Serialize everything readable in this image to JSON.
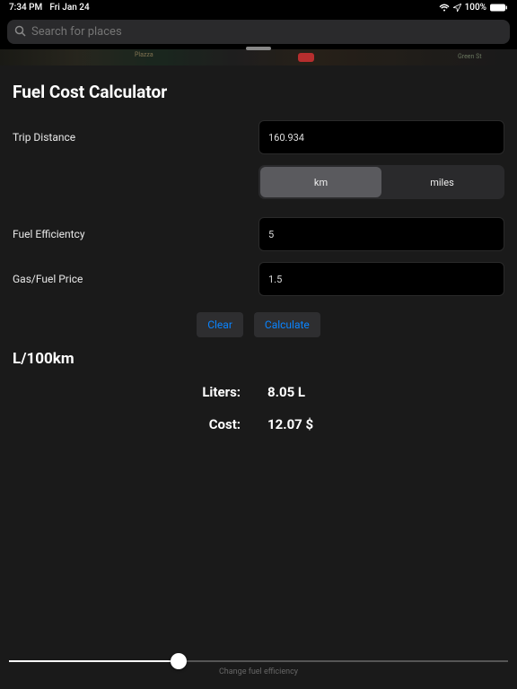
{
  "status": {
    "time": "7:34 PM",
    "date": "Fri Jan 24",
    "battery": "100%"
  },
  "search": {
    "placeholder": "Search for places"
  },
  "map": {
    "label1": "Plazza",
    "label2": "Green St"
  },
  "page": {
    "title": "Fuel Cost Calculator"
  },
  "fields": {
    "trip_distance": {
      "label": "Trip Distance",
      "value": "160.934"
    },
    "fuel_efficiency": {
      "label": "Fuel Efficientcy",
      "value": "5"
    },
    "fuel_price": {
      "label": "Gas/Fuel Price",
      "value": "1.5"
    }
  },
  "units": {
    "km": "km",
    "miles": "miles",
    "selected": "km"
  },
  "buttons": {
    "clear": "Clear",
    "calculate": "Calculate"
  },
  "results": {
    "mode": "L/100km",
    "liters_label": "Liters:",
    "liters_value": "8.05 L",
    "cost_label": "Cost:",
    "cost_value": "12.07 $"
  },
  "slider": {
    "caption": "Change fuel efficiency"
  }
}
